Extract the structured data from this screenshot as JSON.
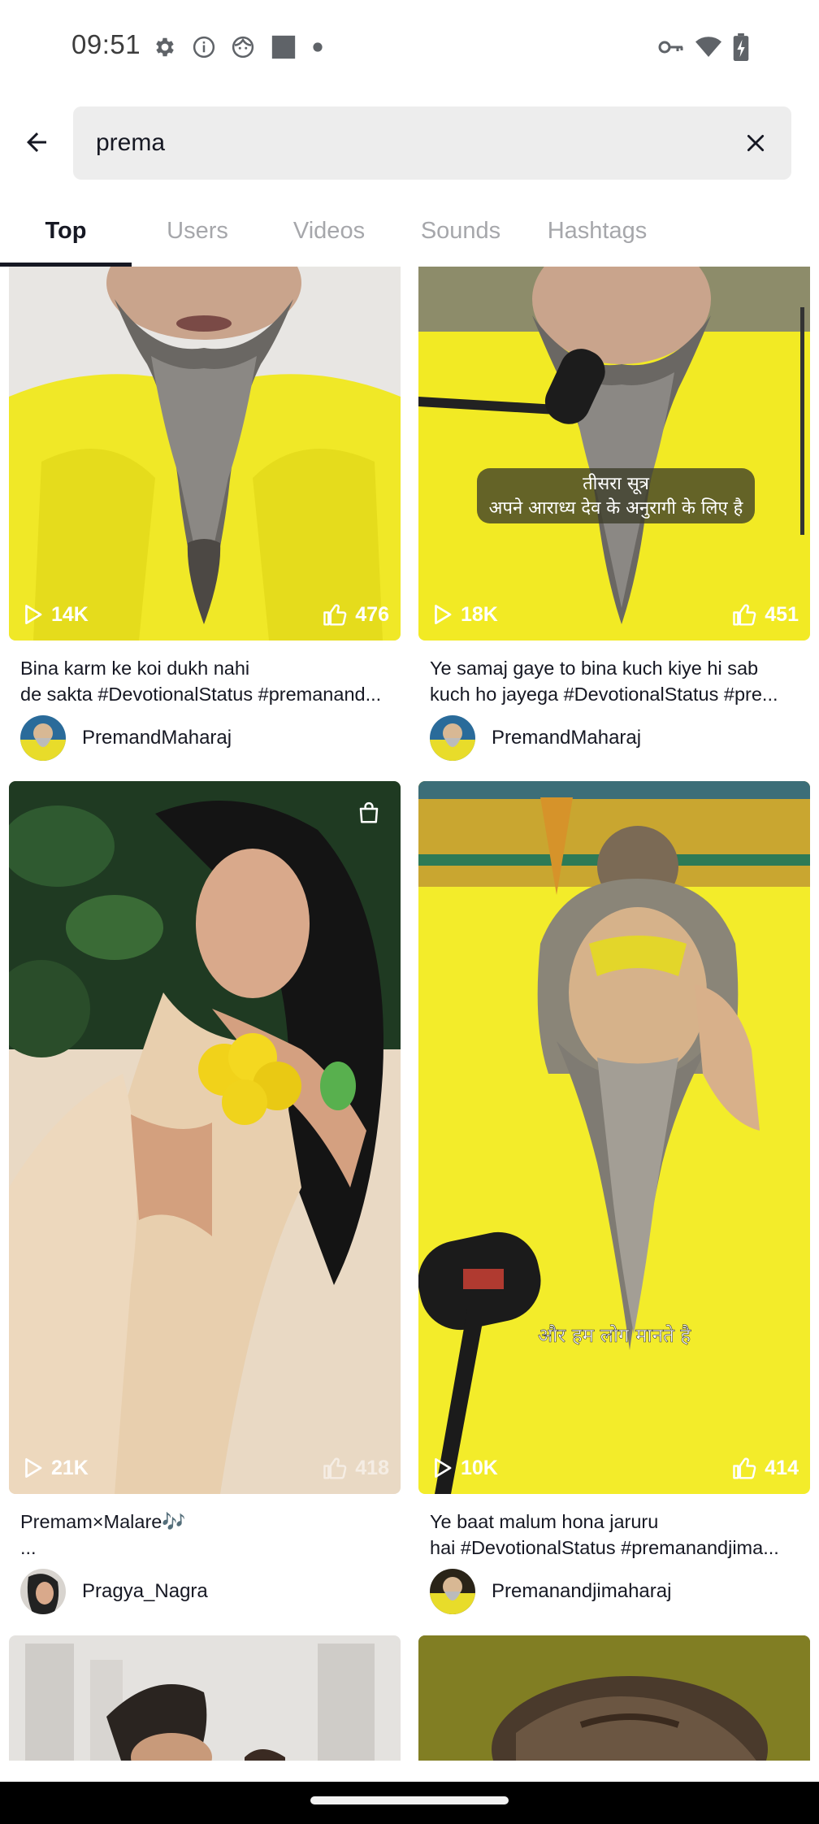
{
  "status_bar": {
    "time": "09:51",
    "left_icons": [
      "gear-icon",
      "info-icon",
      "face-icon",
      "square-icon",
      "dot-icon"
    ],
    "right_icons": [
      "vpn-key-icon",
      "wifi-icon",
      "battery-charging-icon"
    ]
  },
  "search": {
    "query": "prema",
    "placeholder": ""
  },
  "tabs": [
    {
      "label": "Top",
      "active": true
    },
    {
      "label": "Users",
      "active": false
    },
    {
      "label": "Videos",
      "active": false
    },
    {
      "label": "Sounds",
      "active": false
    },
    {
      "label": "Hashtags",
      "active": false
    }
  ],
  "results": [
    {
      "views": "14K",
      "likes": "476",
      "caption_line1": "Bina karm ke koi dukh nahi",
      "caption_line2": "de sakta #DevotionalStatus #premanand...",
      "author": "PremandMaharaj",
      "thumbnail": "bearded-man-yellow"
    },
    {
      "views": "18K",
      "likes": "451",
      "caption_line1": "Ye samaj gaye to bina kuch kiye hi sab",
      "caption_line2": "kuch ho jayega #DevotionalStatus #pre...",
      "author": "PremandMaharaj",
      "overlay_text_1": "तीसरा सूत्र",
      "overlay_text_2": "अपने आराध्य देव के अनुरागी के लिए है",
      "thumbnail": "bearded-man-microphone"
    },
    {
      "views": "21K",
      "likes": "418",
      "caption_line1": "Premam×Malare🎶",
      "caption_line2": "...",
      "author": "Pragya_Nagra",
      "thumbnail": "woman-saree-flowers"
    },
    {
      "views": "10K",
      "likes": "414",
      "caption_line1": "Ye baat malum hona jaruru",
      "caption_line2": "hai #DevotionalStatus #premanandjima...",
      "author": "Premanandjimaharaj",
      "overlay_text_1": "और हम लोग मानते है",
      "thumbnail": "bearded-man-yellow-tilak"
    }
  ],
  "colors": {
    "accent_text": "#161823",
    "inactive_tab": "#a6a7ab",
    "search_bg": "#ededed",
    "yellow_robe": "#f1ea2a"
  }
}
